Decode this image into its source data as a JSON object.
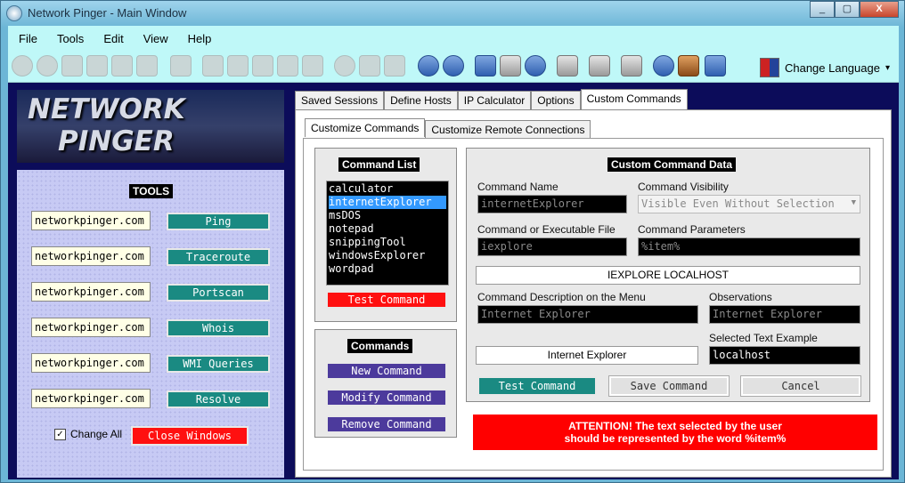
{
  "window": {
    "title": "Network Pinger - Main Window",
    "buttons": [
      "_",
      "▢",
      "X"
    ]
  },
  "menu": [
    "File",
    "Tools",
    "Edit",
    "View",
    "Help"
  ],
  "toolbar": {
    "language_label": "Change Language",
    "language_arrow": "▾"
  },
  "logo": {
    "line1": "NETWORK",
    "line2": "PINGER"
  },
  "tools": {
    "header": "TOOLS",
    "rows": [
      {
        "value": "networkpinger.com",
        "button": "Ping"
      },
      {
        "value": "networkpinger.com",
        "button": "Traceroute"
      },
      {
        "value": "networkpinger.com",
        "button": "Portscan"
      },
      {
        "value": "networkpinger.com",
        "button": "Whois"
      },
      {
        "value": "networkpinger.com",
        "button": "WMI Queries"
      },
      {
        "value": "networkpinger.com",
        "button": "Resolve"
      }
    ],
    "change_all_label": "Change All",
    "change_all_checked": true,
    "change_all_mark": "✓",
    "close_windows": "Close Windows"
  },
  "tabs": [
    "Saved Sessions",
    "Define Hosts",
    "IP Calculator",
    "Options",
    "Custom Commands"
  ],
  "subtabs": [
    "Customize Commands",
    "Customize Remote Connections"
  ],
  "command_list": {
    "header": "Command List",
    "items": [
      "calculator",
      "internetExplorer",
      "msDOS",
      "notepad",
      "snippingTool",
      "windowsExplorer",
      "wordpad"
    ],
    "selected": "internetExplorer",
    "test_button": "Test Command"
  },
  "commands": {
    "header": "Commands",
    "new": "New Command",
    "modify": "Modify Command",
    "remove": "Remove Command"
  },
  "custom_data": {
    "header": "Custom Command Data",
    "name_label": "Command Name",
    "name_value": "internetExplorer",
    "visibility_label": "Command Visibility",
    "visibility_value": "Visible Even Without Selection",
    "exec_label": "Command or Executable File",
    "exec_value": "iexplore",
    "params_label": "Command Parameters",
    "params_value": "%item%",
    "preview": "IEXPLORE LOCALHOST",
    "desc_label": "Command Description on the Menu",
    "desc_value": "Internet Explorer",
    "obs_label": "Observations",
    "obs_value": "Internet Explorer",
    "menu_preview": "Internet Explorer",
    "selected_label": "Selected Text Example",
    "selected_value": "localhost",
    "test_button": "Test Command",
    "save_button": "Save Command",
    "cancel_button": "Cancel",
    "attention_line1": "ATTENTION! The text selected by the user",
    "attention_line2": "should be represented by the word %item%"
  }
}
